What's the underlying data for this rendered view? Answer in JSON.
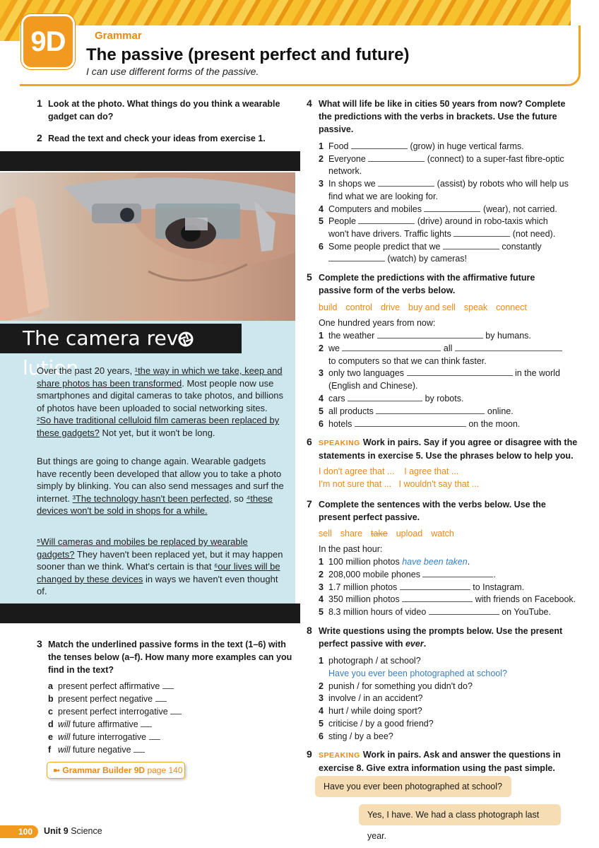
{
  "header": {
    "unit": "9D",
    "section": "Grammar",
    "title": "The passive (present perfect and future)",
    "subtitle": "I can use different forms of the passive."
  },
  "ex1": {
    "num": "1",
    "text": "Look at the photo. What things do you think a wearable gadget can do?"
  },
  "ex2": {
    "num": "2",
    "text": "Read the text and check your ideas from exercise 1."
  },
  "article": {
    "title_pre": "The camera rev",
    "title_post": "lution",
    "p1": {
      "a": "Over the past 20 years, ",
      "s1": "¹the way in which we take, keep and share photos has been transformed",
      "b": ". Most people now use smartphones and digital cameras to take photos, and billions of photos have been uploaded to social networking sites. ",
      "s2": "²So have traditional celluloid film cameras been replaced by these gadgets?",
      "c": " Not yet, but it won't be long."
    },
    "p2": {
      "a": "But things are going to change again. Wearable gadgets have recently been developed that allow you to take a photo simply by blinking. You can also send messages and surf the internet. ",
      "s3": "³The technology hasn't been perfected",
      "b": ", so ",
      "s4": "⁴these devices won't be sold in shops for a while."
    },
    "p3": {
      "s5": "⁵Will cameras and mobiles be replaced by wearable gadgets?",
      "a": " They haven't been replaced yet, but it may happen sooner than we think. What's certain is that ",
      "s6": "⁶our lives will be changed by these devices",
      "b": " in ways we haven't even thought of."
    }
  },
  "ex3": {
    "num": "3",
    "text": "Match the underlined passive forms in the text (1–6) with the tenses below (a–f). How many more examples can you find in the text?",
    "items": [
      {
        "l": "a",
        "pre": "",
        "text": "present perfect affirmative"
      },
      {
        "l": "b",
        "pre": "",
        "text": "present perfect negative"
      },
      {
        "l": "c",
        "pre": "",
        "text": "present perfect interrogative"
      },
      {
        "l": "d",
        "pre": "will",
        "text": " future affirmative"
      },
      {
        "l": "e",
        "pre": "will",
        "text": " future interrogative"
      },
      {
        "l": "f",
        "pre": "will",
        "text": " future negative"
      }
    ]
  },
  "grammar_builder": {
    "label": "Grammar Builder 9D",
    "page": "page 140"
  },
  "ex4": {
    "num": "4",
    "text": "What will life be like in cities 50 years from now? Complete the predictions with the verbs in brackets. Use the future passive.",
    "items": [
      {
        "n": "1",
        "a": "Food ",
        "b": " (grow) in huge vertical farms."
      },
      {
        "n": "2",
        "a": "Everyone ",
        "b": " (connect) to a super-fast fibre-optic"
      },
      {
        "n": "",
        "a": "network."
      },
      {
        "n": "3",
        "a": "In shops we ",
        "b": " (assist) by robots who will help us"
      },
      {
        "n": "",
        "a": "find what we are looking for."
      },
      {
        "n": "4",
        "a": "Computers and mobiles ",
        "b": " (wear), not carried."
      },
      {
        "n": "5",
        "a": "People ",
        "b": " (drive) around in robo-taxis which"
      },
      {
        "n": "",
        "a": "won't have drivers. Traffic lights ",
        "b": " (not need)."
      },
      {
        "n": "6",
        "a": "Some people predict that we ",
        "b": " constantly"
      },
      {
        "n": "",
        "a": "",
        "b": " (watch) by cameras!"
      }
    ]
  },
  "ex5": {
    "num": "5",
    "text": "Complete the predictions with the affirmative future passive form of the verbs below.",
    "verbs": [
      "build",
      "control",
      "drive",
      "buy and sell",
      "speak",
      "connect"
    ],
    "intro": "One hundred years from now:",
    "items": [
      {
        "n": "1",
        "a": "the weather ",
        "b": " by humans."
      },
      {
        "n": "2",
        "a": "we ",
        "b": " all "
      },
      {
        "n": "",
        "a": "to computers so that we can think faster."
      },
      {
        "n": "3",
        "a": "only two languages ",
        "b": " in the world"
      },
      {
        "n": "",
        "a": "(English and Chinese)."
      },
      {
        "n": "4",
        "a": "cars ",
        "b": " by robots."
      },
      {
        "n": "5",
        "a": "all products ",
        "b": " online."
      },
      {
        "n": "6",
        "a": "hotels ",
        "b": " on the moon."
      }
    ]
  },
  "ex6": {
    "num": "6",
    "speaking": "SPEAKING",
    "text": "Work in pairs. Say if you agree or disagree with the statements in exercise 5. Use the phrases below to help you.",
    "phrases": [
      "I don't agree that ...",
      "I agree that ...",
      "I'm not sure that ...",
      "I wouldn't say that ..."
    ]
  },
  "ex7": {
    "num": "7",
    "text": "Complete the sentences with the verbs below. Use the present perfect passive.",
    "verbs": [
      "sell",
      "share",
      "take",
      "upload",
      "watch"
    ],
    "intro": "In the past hour:",
    "items": [
      {
        "n": "1",
        "a": "100 million photos ",
        "ans": "have been taken",
        "b": "."
      },
      {
        "n": "2",
        "a": "208,000 mobile phones ",
        "b": "."
      },
      {
        "n": "3",
        "a": "1.7 million photos ",
        "b": " to Instagram."
      },
      {
        "n": "4",
        "a": "350 million photos ",
        "b": " with friends on Facebook."
      },
      {
        "n": "5",
        "a": "8.3 million hours of video ",
        "b": " on YouTube."
      }
    ]
  },
  "ex8": {
    "num": "8",
    "text": "Write questions using the prompts below. Use the present perfect passive with ",
    "text_em": "ever",
    "text_end": ".",
    "items": [
      {
        "n": "1",
        "a": "photograph / at school?"
      },
      {
        "n": "",
        "a": "Have you ever been photographed at school?",
        "blue": true
      },
      {
        "n": "2",
        "a": "punish / for something you didn't do?"
      },
      {
        "n": "3",
        "a": "involve / in an accident?"
      },
      {
        "n": "4",
        "a": "hurt / while doing sport?"
      },
      {
        "n": "5",
        "a": "criticise / by a good friend?"
      },
      {
        "n": "6",
        "a": "sting / by a bee?"
      }
    ]
  },
  "ex9": {
    "num": "9",
    "speaking": "SPEAKING",
    "text": "Work in pairs. Ask and answer the questions in exercise 8. Give extra information using the past simple.",
    "bubble_a": "Have you ever been photographed at school?",
    "bubble_b": "Yes, I have. We had a class photograph last year."
  },
  "footer": {
    "page": "100",
    "unit": "Unit 9",
    "topic": " Science"
  },
  "colors": {
    "accent": "#f29a1f",
    "article_bg": "#cde7ee",
    "answer": "#3a7fc0"
  }
}
